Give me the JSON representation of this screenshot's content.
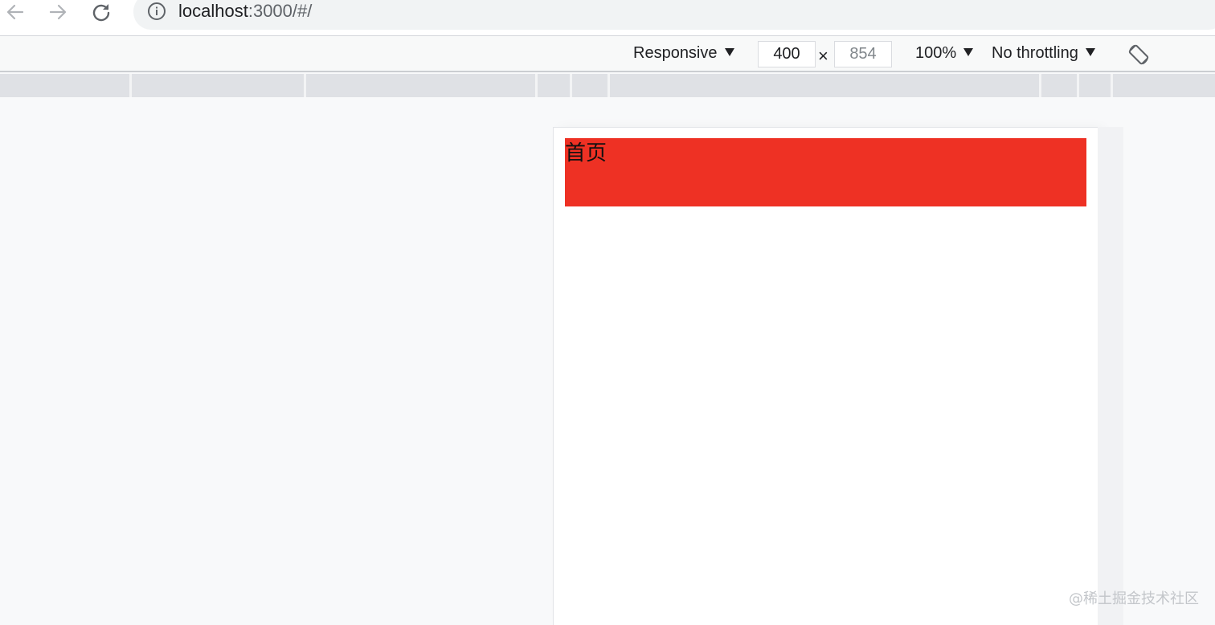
{
  "browser": {
    "url_host": "localhost",
    "url_path": ":3000/#/"
  },
  "device_toolbar": {
    "device_mode": "Responsive",
    "width_value": "400",
    "height_value": "854",
    "times_sign": "×",
    "zoom": "100%",
    "throttling": "No throttling"
  },
  "page": {
    "header_title": "首页",
    "header_color": "#ee3124"
  },
  "watermark": "@稀土掘金技术社区",
  "icons": {
    "back": "arrow-left-icon",
    "forward": "arrow-right-icon",
    "reload": "reload-icon",
    "site_info": "info-circle-icon",
    "rotate": "rotate-device-icon"
  }
}
